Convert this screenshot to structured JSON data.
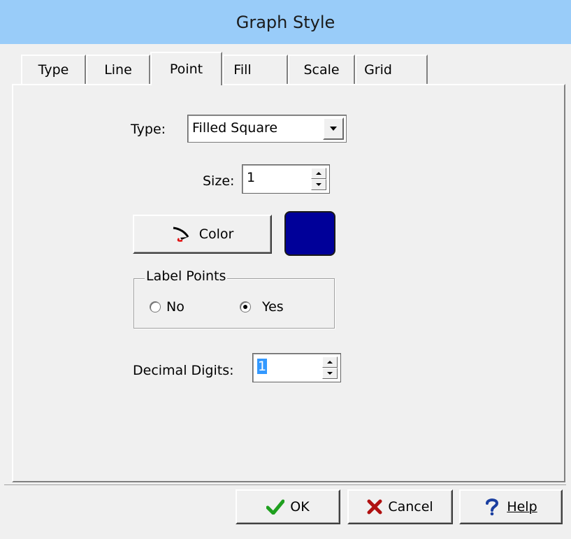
{
  "window": {
    "title": "Graph Style"
  },
  "tabs": [
    {
      "label": "Type",
      "active": false
    },
    {
      "label": "Line",
      "active": false
    },
    {
      "label": "Point",
      "active": true
    },
    {
      "label": "Fill",
      "active": false
    },
    {
      "label": "Scale",
      "active": false
    },
    {
      "label": "Grid",
      "active": false
    }
  ],
  "point": {
    "type_label": "Type:",
    "type_value": "Filled Square",
    "size_label": "Size:",
    "size_value": "1",
    "color_button": "Color",
    "color_value": "#000099",
    "label_points": {
      "legend": "Label Points",
      "no_label": "No",
      "yes_label": "Yes",
      "selected": "Yes"
    },
    "decimal_label": "Decimal Digits:",
    "decimal_value": "1"
  },
  "buttons": {
    "ok": "OK",
    "cancel": "Cancel",
    "help": "Help"
  },
  "icons": {
    "ok": "checkmark-icon",
    "cancel": "x-icon",
    "help": "question-icon",
    "color": "paint-brush-icon"
  },
  "colors": {
    "titlebar": "#99ccf9",
    "ok_check": "#1fa01f",
    "cancel_x": "#b01010",
    "help_q": "#1a3ea0"
  }
}
